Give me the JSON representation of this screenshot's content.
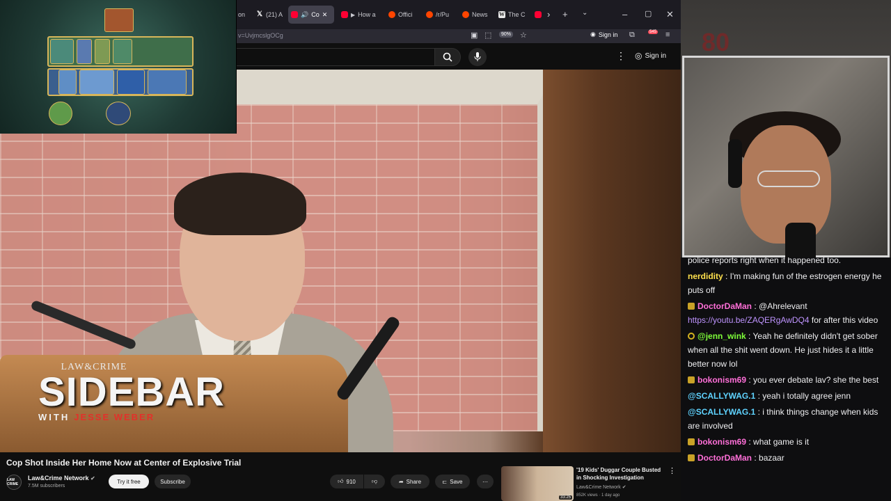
{
  "browser": {
    "tabs": [
      {
        "label": "on",
        "favicon": "globe-icon"
      },
      {
        "label": "(21) A",
        "favicon": "x-icon"
      },
      {
        "label": "Co",
        "favicon": "youtube-icon",
        "active": true
      },
      {
        "label": "How a",
        "favicon": "youtube-icon"
      },
      {
        "label": "Offici",
        "favicon": "reddit-icon"
      },
      {
        "label": "/r/Pu",
        "favicon": "reddit-icon"
      },
      {
        "label": "News",
        "favicon": "reddit-icon"
      },
      {
        "label": "The C",
        "favicon": "wikipedia-icon"
      },
      {
        "label": "",
        "favicon": "youtube-icon"
      }
    ],
    "url": "v=UvjmcslgOCg",
    "zoom": "90%",
    "signin_label": "Sign in",
    "notifications": "545"
  },
  "youtube": {
    "signin_label": "Sign in",
    "video": {
      "title": "Cop Shot Inside Her Home Now at Center of Explosive Trial",
      "overlay_top": "LAW&CRIME",
      "overlay_main": "SIDEBAR",
      "overlay_with": "WITH",
      "overlay_host": "JESSE WEBER"
    },
    "channel": {
      "name": "Law&Crime Network",
      "subscribers": "7.5M subscribers",
      "avatar_text": "LAW CRIME"
    },
    "actions": {
      "try_free": "Try it free",
      "subscribe": "Subscribe",
      "likes": "910",
      "share": "Share",
      "save": "Save"
    },
    "recommended": {
      "title": "'19 Kids' Duggar Couple Busted in Shocking Investigation",
      "channel": "Law&Crime Network",
      "meta": "852K views · 1 day ago",
      "duration": "33:25"
    }
  },
  "webcam": {
    "sign_text": "80"
  },
  "chat": {
    "link_color": "#bf94ff",
    "messages": [
      {
        "badge": "",
        "user": "",
        "user_color": "#efeff1",
        "text": "police reports right when it happened too."
      },
      {
        "badge": "",
        "user": "nerdidity",
        "user_color": "#ffe14d",
        "text": " : I'm making fun of the estrogen energy he puts off"
      },
      {
        "badge": "gold",
        "user": "DoctorDaMan",
        "user_color": "#ff6fd8",
        "text": " : @Ahrelevant ",
        "link": "https://youtu.be/ZAQERgAwDQ4",
        "after": " for after this video"
      },
      {
        "badge": "ring",
        "user": "@jenn_wink",
        "user_color": "#7fff3a",
        "text": " : Yeah he definitely didn't get sober when all the shit went down. He just hides it a little better now lol"
      },
      {
        "badge": "gold",
        "user": "bokonism69",
        "user_color": "#ff6fd8",
        "text": " : you ever debate lav? she the best"
      },
      {
        "badge": "",
        "user": "@SCALLYWAG.1",
        "user_color": "#5fd3ff",
        "text": " : yeah i totally agree jenn"
      },
      {
        "badge": "",
        "user": "@SCALLYWAG.1",
        "user_color": "#5fd3ff",
        "text": " : i think things change when kids are involved"
      },
      {
        "badge": "gold",
        "user": "bokonism69",
        "user_color": "#ff6fd8",
        "text": " : what game is it"
      },
      {
        "badge": "gold",
        "user": "DoctorDaMan",
        "user_color": "#ff6fd8",
        "text": " : bazaar"
      }
    ]
  }
}
